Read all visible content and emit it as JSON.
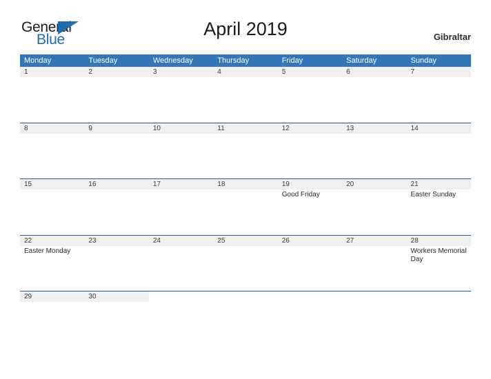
{
  "header": {
    "logo": {
      "text_top": "General",
      "text_bottom": "Blue",
      "flag_icon": "blue-triangle-flag-icon"
    },
    "title": "April 2019",
    "region": "Gibraltar"
  },
  "calendar": {
    "weekdays": [
      "Monday",
      "Tuesday",
      "Wednesday",
      "Thursday",
      "Friday",
      "Saturday",
      "Sunday"
    ],
    "colors": {
      "header_blue": "#3377bb",
      "rule_blue": "#1f5c96",
      "day_band_gray": "#f0f0f0",
      "logo_blue": "#1f6cb0",
      "page_background": "#fdfdfd"
    },
    "weeks": [
      {
        "short": false,
        "days": [
          {
            "num": "1",
            "events": []
          },
          {
            "num": "2",
            "events": []
          },
          {
            "num": "3",
            "events": []
          },
          {
            "num": "4",
            "events": []
          },
          {
            "num": "5",
            "events": []
          },
          {
            "num": "6",
            "events": []
          },
          {
            "num": "7",
            "events": []
          }
        ]
      },
      {
        "short": false,
        "days": [
          {
            "num": "8",
            "events": []
          },
          {
            "num": "9",
            "events": []
          },
          {
            "num": "10",
            "events": []
          },
          {
            "num": "11",
            "events": []
          },
          {
            "num": "12",
            "events": []
          },
          {
            "num": "13",
            "events": []
          },
          {
            "num": "14",
            "events": []
          }
        ]
      },
      {
        "short": false,
        "days": [
          {
            "num": "15",
            "events": []
          },
          {
            "num": "16",
            "events": []
          },
          {
            "num": "17",
            "events": []
          },
          {
            "num": "18",
            "events": []
          },
          {
            "num": "19",
            "events": [
              "Good Friday"
            ]
          },
          {
            "num": "20",
            "events": []
          },
          {
            "num": "21",
            "events": [
              "Easter Sunday"
            ]
          }
        ]
      },
      {
        "short": false,
        "days": [
          {
            "num": "22",
            "events": [
              "Easter Monday"
            ]
          },
          {
            "num": "23",
            "events": []
          },
          {
            "num": "24",
            "events": []
          },
          {
            "num": "25",
            "events": []
          },
          {
            "num": "26",
            "events": []
          },
          {
            "num": "27",
            "events": []
          },
          {
            "num": "28",
            "events": [
              "Workers Memorial Day"
            ]
          }
        ]
      },
      {
        "short": true,
        "days": [
          {
            "num": "29",
            "events": []
          },
          {
            "num": "30",
            "events": []
          },
          {
            "num": "",
            "events": []
          },
          {
            "num": "",
            "events": []
          },
          {
            "num": "",
            "events": []
          },
          {
            "num": "",
            "events": []
          },
          {
            "num": "",
            "events": []
          }
        ]
      }
    ]
  }
}
